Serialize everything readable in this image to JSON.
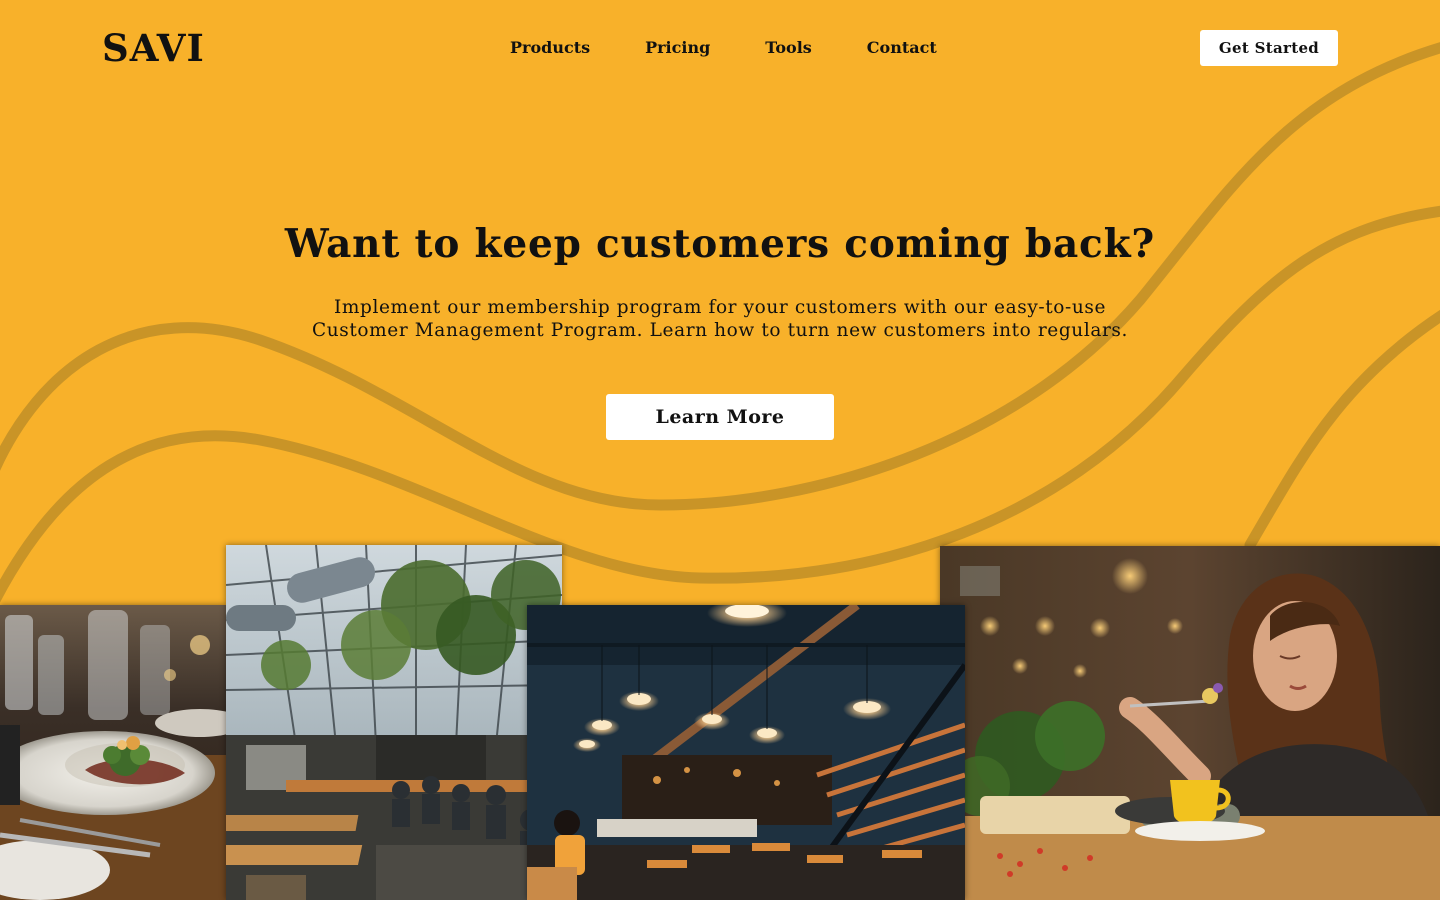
{
  "brand": {
    "name": "SAVI"
  },
  "nav": {
    "items": [
      "Products",
      "Pricing",
      "Tools",
      "Contact"
    ],
    "cta_label": "Get Started"
  },
  "hero": {
    "headline": "Want to keep customers coming back?",
    "subtext_line1": "Implement our membership program for your customers with our easy-to-use",
    "subtext_line2": "Customer Management Program. Learn how to turn new customers into regulars.",
    "cta_label": "Learn More"
  },
  "colors": {
    "background": "#F8B12A",
    "wave": "#C99427",
    "button": "#FFFFFF",
    "text": "#111111"
  },
  "gallery": {
    "images": [
      "plated-dish-photo",
      "greenhouse-restaurant-photo",
      "dark-restaurant-interior-photo",
      "woman-eating-photo"
    ]
  }
}
